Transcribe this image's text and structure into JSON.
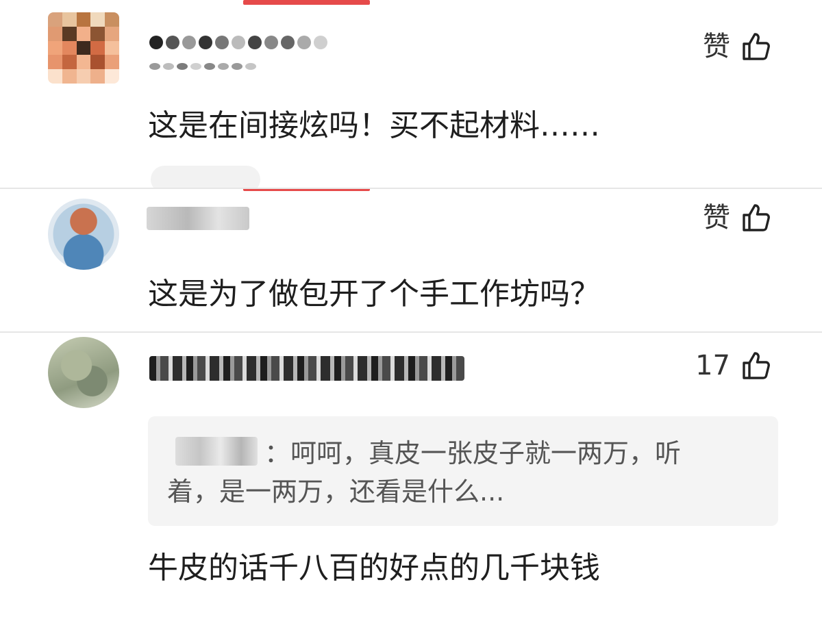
{
  "colors": {
    "accent_red": "#e64a4a",
    "text_main": "#1e1e1e",
    "text_quote": "#555555",
    "quote_bg": "#f4f4f4"
  },
  "comments": [
    {
      "like_label": "赞",
      "like_icon": "thumbs-up-icon",
      "text": "这是在间接炫吗！买不起材料……"
    },
    {
      "like_label": "赞",
      "like_icon": "thumbs-up-icon",
      "text": "这是为了做包开了个手工作坊吗？"
    },
    {
      "like_label": "17",
      "like_icon": "thumbs-up-icon",
      "quote": "：呵呵，真皮一张皮子就一两万，听着，是一两万，还看是什么...",
      "text": "牛皮的话千八百的好点的几千块钱"
    }
  ]
}
